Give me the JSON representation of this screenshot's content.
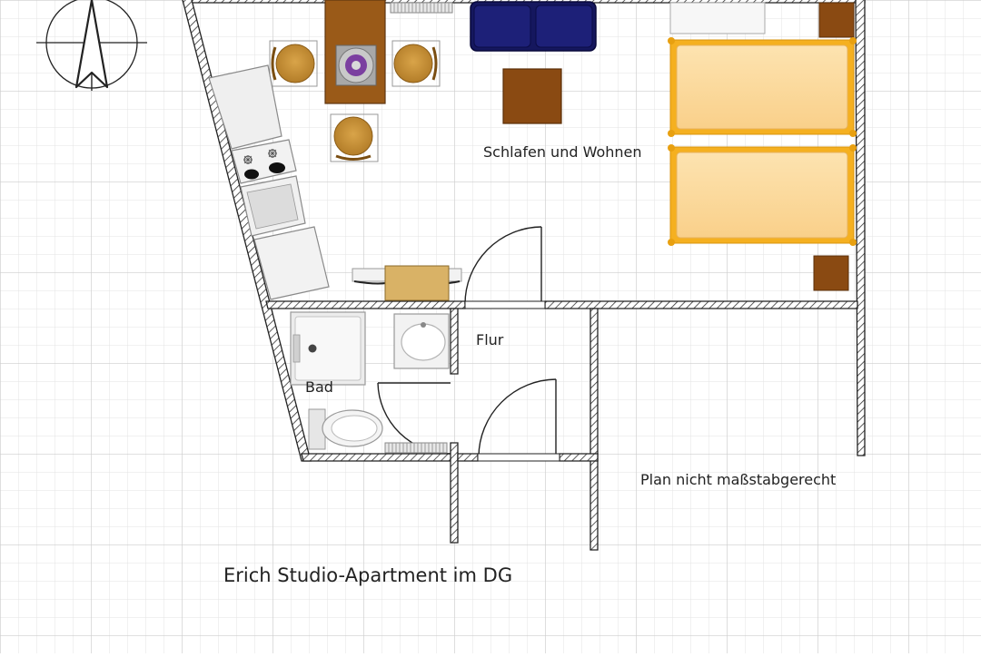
{
  "labels": {
    "living": "Schlafen und Wohnen",
    "hall": "Flur",
    "bath": "Bad",
    "scale_note": "Plan nicht maßstabgerecht",
    "title": "Erich Studio-Apartment im DG"
  },
  "icons": {
    "compass": "north-arrow-icon"
  },
  "colors": {
    "background": "#ffffff",
    "grid_minor": "#e2e2e2",
    "grid_major": "#cfcfcf",
    "wall": "#222222",
    "wood_dark": "#8a4a12",
    "wood_medium": "#9a5a18",
    "chair": "#c8923a",
    "sofa": "#15175e",
    "bed_frame": "#f5b020",
    "bed_mattress": "#fcd99c",
    "appliance": "#f2f2f2",
    "desk": "#d9b266"
  }
}
